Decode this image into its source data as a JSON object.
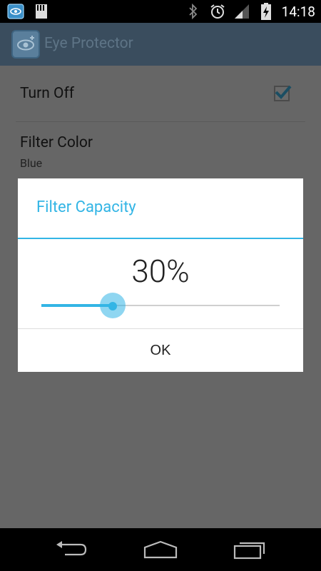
{
  "status_bar": {
    "time": "14:18",
    "icons": [
      "eye-protector-notification-icon",
      "sd-card-icon",
      "bluetooth-icon",
      "alarm-icon",
      "signal-icon",
      "battery-charging-icon"
    ]
  },
  "action_bar": {
    "title": "Eye Protector",
    "icon": "eye-icon"
  },
  "preferences": [
    {
      "title": "Turn Off",
      "checked": true
    },
    {
      "title": "Filter Color",
      "summary": "Blue"
    }
  ],
  "dialog": {
    "title": "Filter Capacity",
    "value_text": "30%",
    "slider_value": 0.3,
    "ok_label": "OK"
  },
  "nav_bar": {
    "buttons": [
      "back-icon",
      "home-icon",
      "recents-icon"
    ]
  },
  "colors": {
    "accent": "#33b5e5",
    "dim_background": "#666666"
  }
}
